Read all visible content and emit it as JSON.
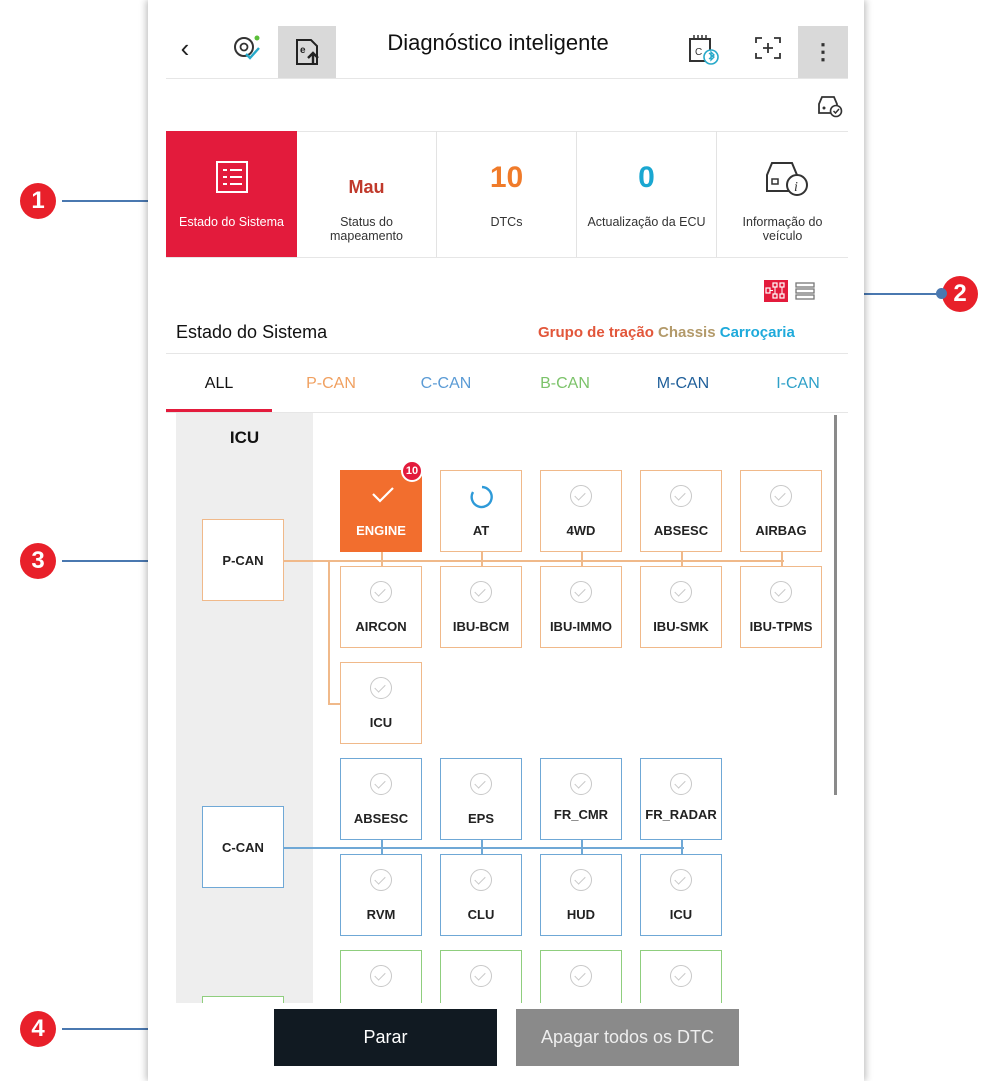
{
  "header": {
    "title": "Diagnóstico inteligente",
    "icons": [
      "back-icon",
      "auto-detect-icon",
      "export-icon",
      "vci-bluetooth-icon",
      "screen-capture-icon",
      "more-icon",
      "vehicle-check-icon"
    ]
  },
  "tiles": [
    {
      "label": "Estado do Sistema"
    },
    {
      "value": "Mau",
      "label_line1": "Status do",
      "label_line2": "mapeamento"
    },
    {
      "value": "10",
      "label": "DTCs"
    },
    {
      "value": "0",
      "label": "Actualização da ECU"
    },
    {
      "label_line1": "Informação do",
      "label_line2": "veículo"
    }
  ],
  "system": {
    "title": "Estado do Sistema",
    "legend": {
      "powertrain": "Grupo de tração",
      "chassis": "Chassis",
      "body": "Carroçaria"
    }
  },
  "tabs": [
    "ALL",
    "P-CAN",
    "C-CAN",
    "B-CAN",
    "M-CAN",
    "I-CAN"
  ],
  "diagram": {
    "gateway": "ICU",
    "pcan": {
      "label": "P-CAN",
      "row1": [
        "ENGINE",
        "AT",
        "4WD",
        "ABSESC",
        "AIRBAG"
      ],
      "row2": [
        "AIRCON",
        "IBU-BCM",
        "IBU-IMMO",
        "IBU-SMK",
        "IBU-TPMS"
      ],
      "row3": [
        "ICU"
      ],
      "engine_badge": "10"
    },
    "ccan": {
      "label": "C-CAN",
      "row1": [
        "ABSESC",
        "EPS",
        "FR_CMR",
        "FR_RADAR"
      ],
      "row2": [
        "RVM",
        "CLU",
        "HUD",
        "ICU"
      ]
    }
  },
  "buttons": {
    "stop": "Parar",
    "clear": "Apagar todos os DTC"
  },
  "callouts": [
    "1",
    "2",
    "3",
    "4"
  ],
  "colors": {
    "accent": "#e31b3c",
    "pcan": "#f0a060",
    "ccan": "#5b9bd5",
    "bcan": "#7cc36a",
    "engine": "#f26e2e",
    "stop_btn": "#111a22",
    "clear_btn": "#8a8a8a"
  }
}
